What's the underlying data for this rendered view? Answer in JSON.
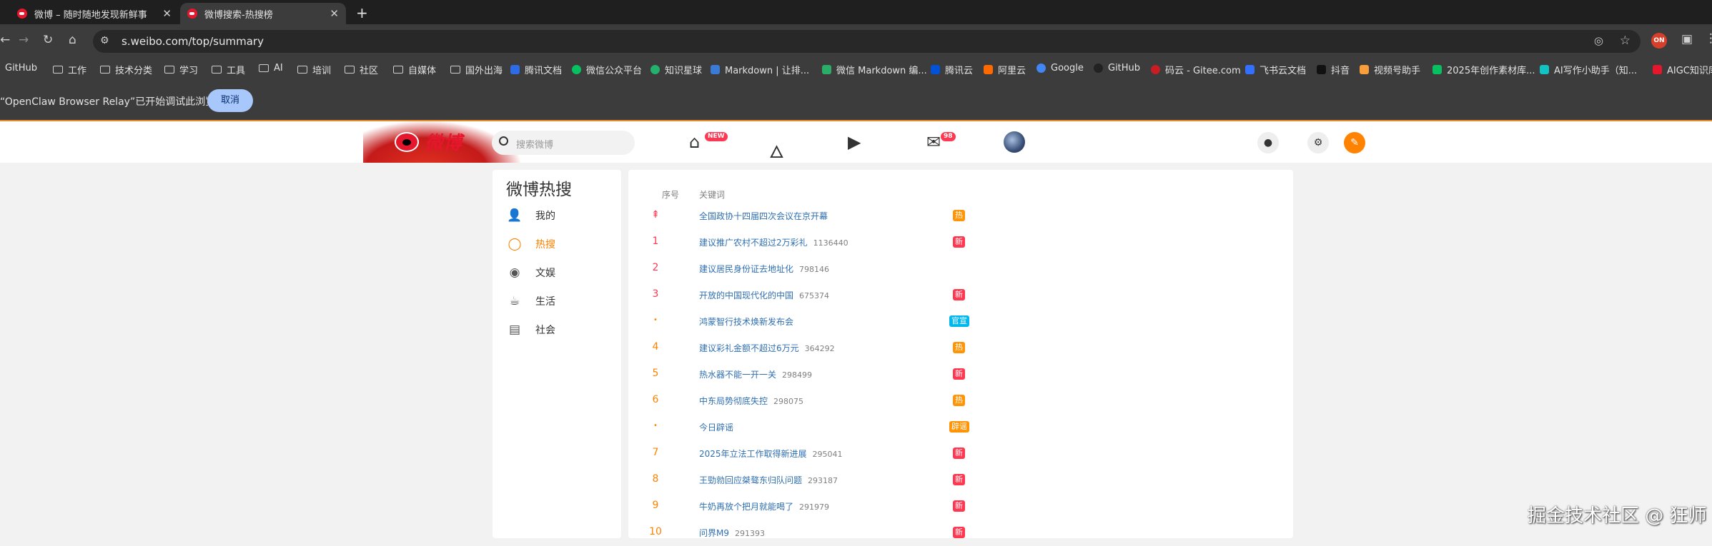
{
  "browser": {
    "tabs": [
      {
        "title": "微博 – 随时随地发现新鲜事",
        "active": false
      },
      {
        "title": "微博搜索-热搜榜",
        "active": true
      }
    ],
    "url": "s.weibo.com/top/summary",
    "ext_badge": "ON",
    "bookmarks": [
      "GitHub",
      "工作",
      "技术分类",
      "学习",
      "工具",
      "AI",
      "培训",
      "社区",
      "自媒体",
      "国外出海",
      "腾讯文档",
      "微信公众平台",
      "知识星球",
      "Markdown | 让排...",
      "微信 Markdown 编...",
      "腾讯云",
      "阿里云",
      "Google",
      "GitHub",
      "码云 - Gitee.com",
      "飞书云文档",
      "抖音",
      "视频号助手",
      "2025年创作素材库...",
      "AI写作小助手（知...",
      "AIGC知识库"
    ],
    "infobar": {
      "message": "“OpenClaw Browser Relay”已开始调试此浏览器",
      "cancel": "取消"
    }
  },
  "weibo": {
    "logo": "微博",
    "search_placeholder": "搜索微博",
    "nav_badges": {
      "home": "NEW",
      "messages": "98"
    },
    "sidebar": {
      "title": "微博热搜",
      "items": [
        {
          "label": "我的",
          "icon": "user-icon",
          "active": false
        },
        {
          "label": "热搜",
          "icon": "search-icon",
          "active": true
        },
        {
          "label": "文娱",
          "icon": "entertainment-icon",
          "active": false
        },
        {
          "label": "生活",
          "icon": "life-icon",
          "active": false
        },
        {
          "label": "社会",
          "icon": "society-icon",
          "active": false
        }
      ]
    },
    "table": {
      "col_rank": "序号",
      "col_keyword": "关键词",
      "rows": [
        {
          "rank": "pin",
          "keyword": "全国政协十四届四次会议在京开幕",
          "count": "",
          "tag": "热",
          "tag_color": "#ff9406"
        },
        {
          "rank": "1",
          "keyword": "建议推广农村不超过2万彩礼",
          "count": "1136440",
          "tag": "新",
          "tag_color": "#ff3852"
        },
        {
          "rank": "2",
          "keyword": "建议居民身份证去地址化",
          "count": "798146",
          "tag": "",
          "tag_color": ""
        },
        {
          "rank": "3",
          "keyword": "开放的中国现代化的中国",
          "count": "675374",
          "tag": "新",
          "tag_color": "#ff3852"
        },
        {
          "rank": "dot",
          "keyword": "鸿蒙智行技术焕新发布会",
          "count": "",
          "tag": "官宣",
          "tag_color": "#00b7ee"
        },
        {
          "rank": "4",
          "keyword": "建议彩礼金额不超过6万元",
          "count": "364292",
          "tag": "热",
          "tag_color": "#ff9406"
        },
        {
          "rank": "5",
          "keyword": "热水器不能一开一关",
          "count": "298499",
          "tag": "新",
          "tag_color": "#ff3852"
        },
        {
          "rank": "6",
          "keyword": "中东局势彻底失控",
          "count": "298075",
          "tag": "热",
          "tag_color": "#ff9406"
        },
        {
          "rank": "dot",
          "keyword": "今日辟谣",
          "count": "",
          "tag": "辟谣",
          "tag_color": "#ff9406"
        },
        {
          "rank": "7",
          "keyword": "2025年立法工作取得新进展",
          "count": "295041",
          "tag": "新",
          "tag_color": "#ff3852"
        },
        {
          "rank": "8",
          "keyword": "王勁勍回应桀骜东归队问题",
          "count": "293187",
          "tag": "新",
          "tag_color": "#ff3852"
        },
        {
          "rank": "9",
          "keyword": "牛奶再放个把月就能喝了",
          "count": "291979",
          "tag": "新",
          "tag_color": "#ff3852"
        },
        {
          "rank": "10",
          "keyword": "问界M9",
          "count": "291393",
          "tag": "新",
          "tag_color": "#ff3852"
        }
      ]
    }
  },
  "watermark": "掘金技术社区 @ 狂师"
}
